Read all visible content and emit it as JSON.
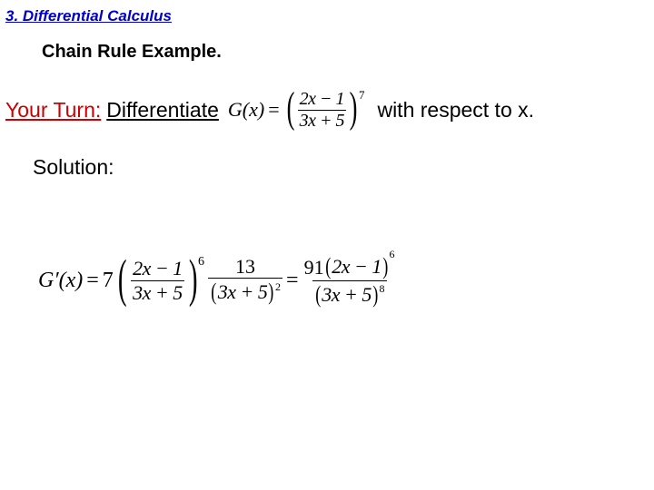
{
  "heading": "3. Differential Calculus",
  "subhead": "Chain Rule Example.",
  "prompt": {
    "your_turn": "Your Turn:",
    "differentiate": "Differentiate",
    "with_respect": "with respect to x."
  },
  "given": {
    "lhs": "G(x)",
    "eq": "=",
    "frac_num": "2x − 1",
    "frac_den": "3x + 5",
    "power": "7"
  },
  "solution_label": "Solution:",
  "solution": {
    "lhs": "G′(x)",
    "eq": "=",
    "coeff1": "7",
    "frac1_num": "2x − 1",
    "frac1_den": "3x + 5",
    "power1": "6",
    "frac2_num": "13",
    "frac2_den_inner": "3x + 5",
    "frac2_den_power": "2",
    "eq2": "=",
    "rhs_num_coeff": "91",
    "rhs_num_inner": "2x − 1",
    "rhs_num_power": "6",
    "rhs_den_inner": "3x + 5",
    "rhs_den_power": "8"
  }
}
